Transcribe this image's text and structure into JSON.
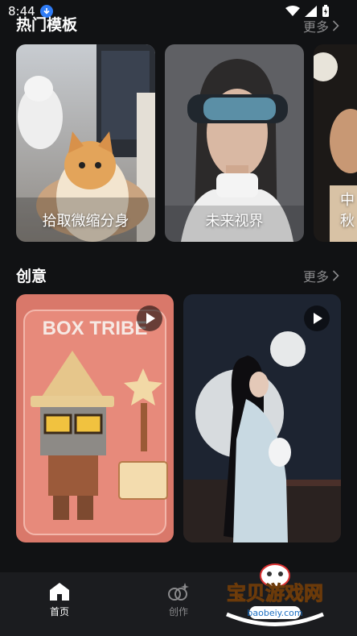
{
  "status": {
    "time": "8:44"
  },
  "hot": {
    "title": "热门模板",
    "more": "更多",
    "cards": [
      {
        "label": "拾取微缩分身"
      },
      {
        "label": "未来视界"
      },
      {
        "label": "中秋"
      }
    ]
  },
  "creative": {
    "title": "创意",
    "more": "更多",
    "cards": [
      {
        "label": "BOX TRIBE"
      },
      {
        "label": ""
      }
    ]
  },
  "tabs": [
    {
      "label": "首页",
      "active": true
    },
    {
      "label": "创作",
      "active": false
    }
  ],
  "watermark": {
    "title": "宝贝游戏网",
    "url": "baobeiy.com"
  },
  "colors": {
    "background": "#111214",
    "tabbar": "#1b1c1f",
    "muted": "#8a8a8c",
    "accent": "#2f7cf6"
  }
}
